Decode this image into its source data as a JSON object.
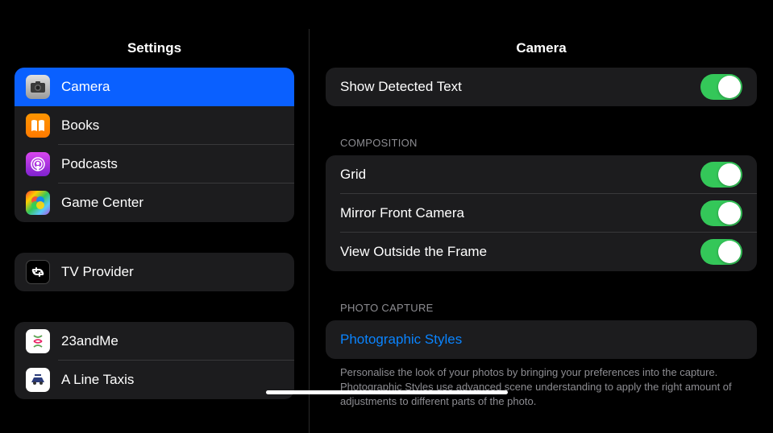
{
  "sidebar": {
    "title": "Settings",
    "groups": [
      {
        "items": [
          {
            "label": "Camera",
            "icon": "camera-icon",
            "selected": true
          },
          {
            "label": "Books",
            "icon": "books-icon"
          },
          {
            "label": "Podcasts",
            "icon": "podcasts-icon"
          },
          {
            "label": "Game Center",
            "icon": "gamecenter-icon"
          }
        ]
      },
      {
        "items": [
          {
            "label": "TV Provider",
            "icon": "tvprovider-icon"
          }
        ]
      },
      {
        "items": [
          {
            "label": "23andMe",
            "icon": "23andme-icon"
          },
          {
            "label": "A Line Taxis",
            "icon": "alinetaxis-icon"
          }
        ]
      }
    ]
  },
  "main": {
    "title": "Camera",
    "top_section": {
      "rows": [
        {
          "label": "Show Detected Text",
          "type": "toggle",
          "on": true
        }
      ]
    },
    "sections": [
      {
        "header": "COMPOSITION",
        "rows": [
          {
            "label": "Grid",
            "type": "toggle",
            "on": true
          },
          {
            "label": "Mirror Front Camera",
            "type": "toggle",
            "on": true
          },
          {
            "label": "View Outside the Frame",
            "type": "toggle",
            "on": true
          }
        ]
      },
      {
        "header": "PHOTO CAPTURE",
        "rows": [
          {
            "label": "Photographic Styles",
            "type": "link"
          }
        ],
        "footer": "Personalise the look of your photos by bringing your preferences into the capture. Photographic Styles use advanced scene understanding to apply the right amount of adjustments to different parts of the photo."
      }
    ]
  }
}
